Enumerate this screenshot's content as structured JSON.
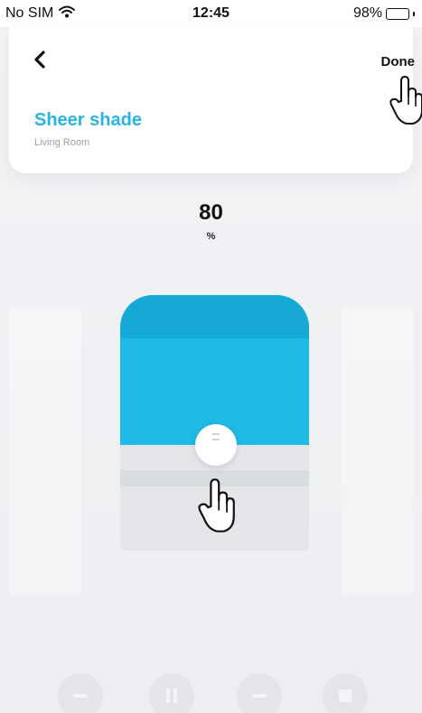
{
  "status_bar": {
    "carrier": "No SIM",
    "time": "12:45",
    "battery": "98%",
    "battery_level": 0.98
  },
  "header": {
    "back_icon": "chevron-left-icon",
    "done_label": "Done"
  },
  "device": {
    "name": "Sheer shade",
    "room": "Living Room"
  },
  "position": {
    "value": "80",
    "unit": "%",
    "level": 0.8
  },
  "controls": [
    {
      "name": "close-button",
      "icon": "close-icon"
    },
    {
      "name": "pause-button",
      "icon": "pause-icon"
    },
    {
      "name": "open-button",
      "icon": "open-icon"
    },
    {
      "name": "stop-button",
      "icon": "stop-icon"
    }
  ],
  "colors": {
    "accent": "#29b4e3",
    "shade_fill": "#1fbbe6"
  }
}
